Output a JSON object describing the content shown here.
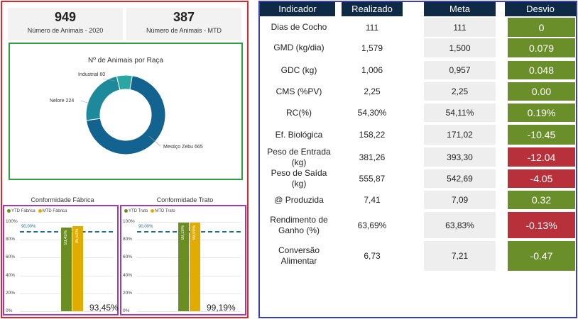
{
  "kpis": [
    {
      "value": "949",
      "label": "Número de Animais - 2020"
    },
    {
      "value": "387",
      "label": "Número de Animais - MTD"
    }
  ],
  "donut": {
    "title": "Nº de Animais por Raça",
    "slices": [
      {
        "name": "Mestiço Zebu",
        "value": 665,
        "color": "#12638f",
        "label": "Mestiço Zebu 665"
      },
      {
        "name": "Nelore",
        "value": 224,
        "color": "#1c8a9a",
        "label": "Nelore 224"
      },
      {
        "name": "Industrial",
        "value": 60,
        "color": "#2ba6a0",
        "label": "Industrial 60"
      }
    ]
  },
  "bar_charts": [
    {
      "title": "Conformidade Fábrica",
      "legend": [
        "YTD Fábrica",
        "MTD Fábrica"
      ],
      "series_colors": [
        "#6b8e23",
        "#e0ac00"
      ],
      "values": [
        93.45,
        95.52
      ],
      "value_labels": [
        "93,45%",
        "95,52%"
      ],
      "target_label": "90,00%",
      "target": 90,
      "big_value": "93,45%",
      "ticks": [
        "100%",
        "80%",
        "60%",
        "40%",
        "20%",
        "0%"
      ]
    },
    {
      "title": "Conformidade Trato",
      "legend": [
        "YTD Trato",
        "MTD Trato"
      ],
      "series_colors": [
        "#6b8e23",
        "#e0ac00"
      ],
      "values": [
        99.19,
        99.09
      ],
      "value_labels": [
        "99,19%",
        "99,09%"
      ],
      "target_label": "90,00%",
      "target": 90,
      "big_value": "99,19%",
      "ticks": [
        "100%",
        "80%",
        "60%",
        "40%",
        "20%",
        "0%"
      ]
    }
  ],
  "table": {
    "headers": [
      "Indicador",
      "Realizado",
      "Meta",
      "Desvio"
    ],
    "rows": [
      {
        "indicador": "Dias de Cocho",
        "realizado": "111",
        "meta": "111",
        "desvio": "0",
        "status": "good"
      },
      {
        "indicador": "GMD (kg/dia)",
        "realizado": "1,579",
        "meta": "1,500",
        "desvio": "0.079",
        "status": "good"
      },
      {
        "indicador": "GDC (kg)",
        "realizado": "1,006",
        "meta": "0,957",
        "desvio": "0.048",
        "status": "good"
      },
      {
        "indicador": "CMS (%PV)",
        "realizado": "2,25",
        "meta": "2,25",
        "desvio": "0.00",
        "status": "good"
      },
      {
        "indicador": "RC(%)",
        "realizado": "54,30%",
        "meta": "54,11%",
        "desvio": "0.19%",
        "status": "good"
      },
      {
        "indicador": "Ef. Biológica",
        "realizado": "158,22",
        "meta": "171,02",
        "desvio": "-10.45",
        "status": "good"
      },
      {
        "indicador": "Peso de Entrada (kg)",
        "realizado": "381,26",
        "meta": "393,30",
        "desvio": "-12.04",
        "status": "bad"
      },
      {
        "indicador": "Peso de Saída (kg)",
        "realizado": "555,87",
        "meta": "542,69",
        "desvio": "-4.05",
        "status": "bad"
      },
      {
        "indicador": "@ Produzida",
        "realizado": "7,41",
        "meta": "7,09",
        "desvio": "0.32",
        "status": "good"
      },
      {
        "indicador": "Rendimento de Ganho (%)",
        "realizado": "63,69%",
        "meta": "63,83%",
        "desvio": "-0.13%",
        "status": "bad"
      },
      {
        "indicador": "Conversão Alimentar",
        "realizado": "6,73",
        "meta": "7,21",
        "desvio": "-0.47",
        "status": "good"
      }
    ],
    "status_colors": {
      "good": "#6a8f2a",
      "bad": "#b8303a"
    }
  }
}
